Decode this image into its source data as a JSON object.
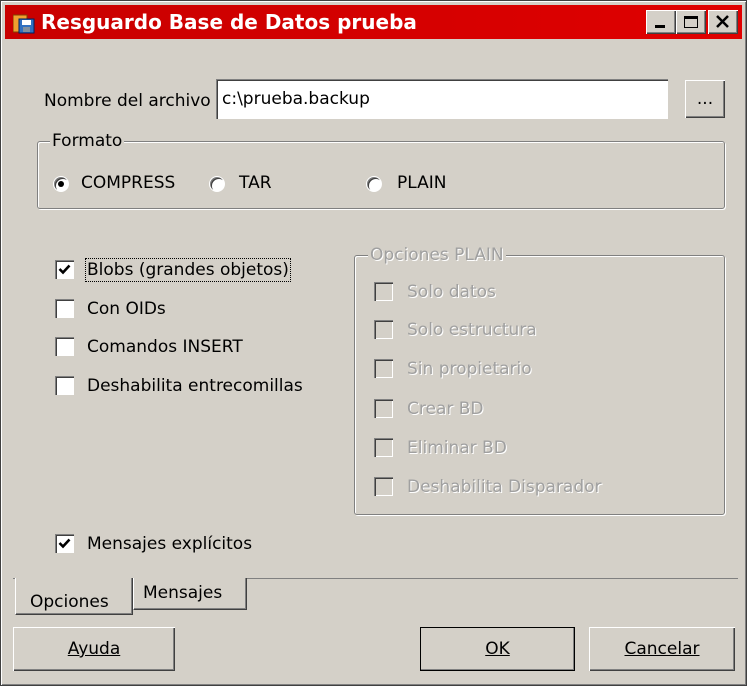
{
  "window": {
    "title": "Resguardo Base de Datos prueba",
    "title_bar_color": "#d40000"
  },
  "titlebar_buttons": [
    "minimize-icon",
    "maximize-icon",
    "close-icon"
  ],
  "file": {
    "label": "Nombre del archivo",
    "value": "c:\\prueba.backup",
    "browse_label": "..."
  },
  "format": {
    "title": "Formato",
    "options": [
      {
        "label": "COMPRESS",
        "selected": true
      },
      {
        "label": "TAR",
        "selected": false
      },
      {
        "label": "PLAIN",
        "selected": false
      }
    ]
  },
  "options": [
    {
      "label": "Blobs (grandes objetos)",
      "checked": true
    },
    {
      "label": "Con OIDs",
      "checked": false
    },
    {
      "label": "Comandos INSERT",
      "checked": false
    },
    {
      "label": "Deshabilita entrecomillas",
      "checked": false
    }
  ],
  "plain_options": {
    "title": "Opciones PLAIN",
    "enabled": false,
    "items": [
      {
        "label": "Solo datos",
        "checked": false
      },
      {
        "label": "Solo estructura",
        "checked": false
      },
      {
        "label": "Sin propietario",
        "checked": false
      },
      {
        "label": "Crear BD",
        "checked": false
      },
      {
        "label": "Eliminar BD",
        "checked": false
      },
      {
        "label": "Deshabilita Disparador",
        "checked": false
      }
    ]
  },
  "verbose": {
    "label": "Mensajes explícitos",
    "checked": true
  },
  "tabs": [
    {
      "label": "Opciones",
      "active": true
    },
    {
      "label": "Mensajes",
      "active": false
    }
  ],
  "buttons": {
    "help": "Ayuda",
    "ok": "OK",
    "cancel": "Cancelar"
  }
}
